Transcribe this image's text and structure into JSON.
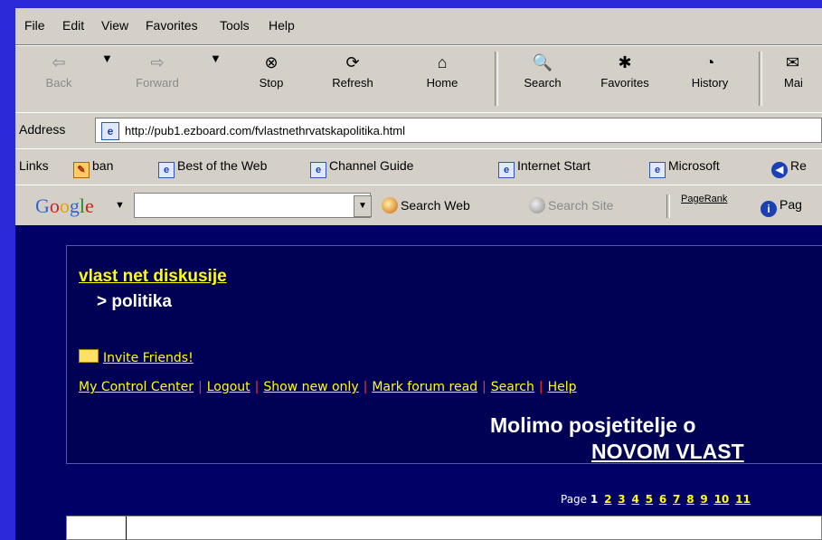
{
  "menu": [
    "File",
    "Edit",
    "View",
    "Favorites",
    "Tools",
    "Help"
  ],
  "toolbar": {
    "back": "Back",
    "forward": "Forward",
    "stop": "Stop",
    "refresh": "Refresh",
    "home": "Home",
    "search": "Search",
    "favorites": "Favorites",
    "history": "History",
    "mail": "Mai"
  },
  "address": {
    "label": "Address",
    "url": "http://pub1.ezboard.com/fvlastnethrvatskapolitika.html"
  },
  "links": {
    "label": "Links",
    "items": [
      "ban",
      "Best of the Web",
      "Channel Guide",
      "Internet Start",
      "Microsoft",
      "Re"
    ]
  },
  "google": {
    "logo": "Google",
    "search_value": "",
    "search_web": "Search Web",
    "search_site": "Search Site",
    "pagerank": "PageRank",
    "page_info": "Pag"
  },
  "forum": {
    "title": "vlast net diskusije",
    "subtitle": "> politika",
    "invite": "Invite Friends!",
    "nav": [
      "My Control Center",
      "Logout",
      "Show new only",
      "Mark forum read",
      "Search",
      "Help"
    ],
    "notice_line1": "Molimo posjetitelje o",
    "notice_line2": "NOVOM VLAST"
  },
  "pager": {
    "label": "Page",
    "current": "1",
    "pages": [
      "2",
      "3",
      "4",
      "5",
      "6",
      "7",
      "8",
      "9",
      "10",
      "11"
    ]
  }
}
